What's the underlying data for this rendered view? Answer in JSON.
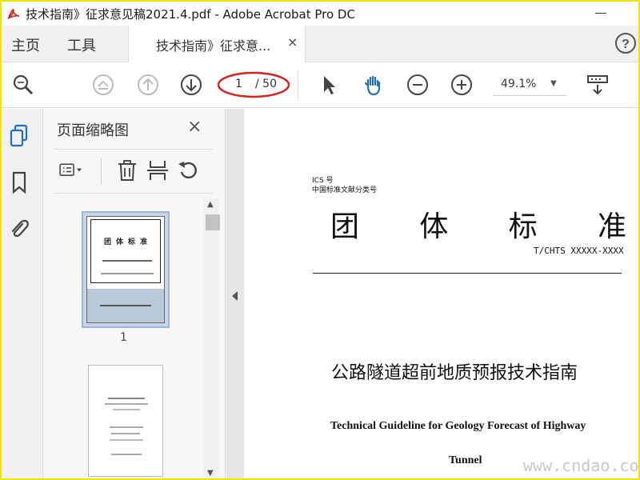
{
  "window": {
    "title": "技术指南》征求意见稿2021.4.pdf - Adobe Acrobat Pro DC"
  },
  "tabs": {
    "home": "主页",
    "tools": "工具",
    "document": "技术指南》征求意...",
    "close": "×"
  },
  "toolbar": {
    "page_current": "1",
    "page_total": "/ 50",
    "zoom": "49.1%"
  },
  "panel": {
    "title": "页面缩略图",
    "close": "×",
    "thumbnails": [
      {
        "label": "1"
      }
    ],
    "thumb1_title": "团体标准"
  },
  "document": {
    "ics": "ICS 号",
    "classification": "中国标准文献分类号",
    "heading_chars": [
      "团",
      "体",
      "标",
      "准"
    ],
    "standard_number": "T/CHTS XXXXX-XXXX",
    "title_cn": "公路隧道超前地质预报技术指南",
    "title_en_line1": "Technical Guideline for Geology Forecast of Highway",
    "title_en_line2": "Tunnel"
  },
  "watermark": "www.cndao.com",
  "colors": {
    "accent_blue": "#1f6fc2",
    "annotation_red": "#d9241c",
    "frame_yellow": "#f1e400"
  }
}
